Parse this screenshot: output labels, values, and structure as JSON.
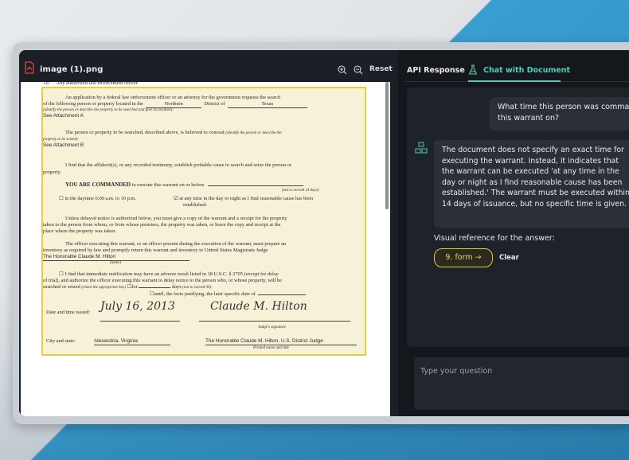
{
  "document_panel": {
    "file_title": "image (1).png",
    "reset_label": "Reset",
    "zoom_in_icon": "zoom-in-icon",
    "zoom_out_icon": "zoom-out-icon"
  },
  "warrant": {
    "to_label": "To:",
    "to_text": "Any authorized law enforcement officer",
    "application_line": "An application by a federal law enforcement officer or an attorney for the government requests the search",
    "location_line_prefix": "of the following person or property located in the",
    "district_value": "Northern",
    "district_of": "District of",
    "state_value": "Texas",
    "identify_hint": "(identify the person or describe the property to be searched and give its location):",
    "attachment_a": "See Attachment A",
    "seized_line": "The person or property to be searched, described above, is believed to conceal",
    "seized_hint": "(identify the person or describe the",
    "seized_hint2": "property to be seized):",
    "attachment_b": "See Attachment B",
    "affidavit_line": "I find that the affidavit(s), or any recorded testimony, establish probable cause to search and seize the person or",
    "property_word": "property.",
    "commanded": "YOU ARE COMMANDED",
    "commanded_rest": "to execute this warrant on or before",
    "not_exceed": "(not to exceed 14 days)",
    "daytime": "in the daytime 6:00 a.m. to 10 p.m.",
    "anytime": "at any time in the day or night as I find reasonable cause has been",
    "established": "established.",
    "notice_1": "Unless delayed notice is authorized below, you must give a copy of the warrant and a receipt for the property",
    "notice_2": "taken to the person from whom, or from whose premises, the property was taken, or leave the copy and receipt at the",
    "notice_3": "place where the property was taken.",
    "officer_1": "The officer executing this warrant, or an officer present during the execution of the warrant, must prepare an",
    "officer_2": "inventory as required by law and promptly return this warrant and inventory to United States Magistrate Judge",
    "judge_name": "The Honorable Claude M. Hilton",
    "name_label": "(name)",
    "delay_1": "I find that immediate notification may have an adverse result listed in 18 U.S.C. § 2705 (except for delay",
    "delay_2": "of trial), and authorize the officer executing this warrant to delay notice to the person who, or whose property, will be",
    "delay_3": "searched or seized",
    "check_box_hint": "(check the appropriate box)",
    "for_label": "for",
    "days_label": "days",
    "not_exceed_30": "(not to exceed 30).",
    "until_label": "until, the facts justifying, the later specific date of",
    "date_time_label": "Date and time issued:",
    "date_value": "July 16, 2013",
    "signature_text": "Claude M. Hilton",
    "judge_signature_label": "Judge's signature",
    "city_label": "City and state:",
    "city_value": "Alexandria, Virginia",
    "printed_name": "The Honorable Claude M. Hilton, U.S. District Judge",
    "printed_name_label": "Printed name and title"
  },
  "tabs": {
    "api": "API Response",
    "chat": "Chat with Document"
  },
  "chat": {
    "user_message_line1": "What time this person was comman",
    "user_message_line2": "this warrant on?",
    "bot_message": "The document does not specify an exact time for executing the warrant. Instead, it indicates that the warrant can be executed 'at any time in the day or night as I find reasonable cause has been established.' The warrant must be executed within 14 days of issuance, but no specific time is given.",
    "visual_reference_label": "Visual reference for the answer:",
    "reference_button": "9. form →",
    "clear_label": "Clear",
    "input_placeholder": "Type your question"
  },
  "colors": {
    "accent": "#4fd1b0",
    "highlight": "#e6c72a",
    "panel": "#1b1f26"
  }
}
